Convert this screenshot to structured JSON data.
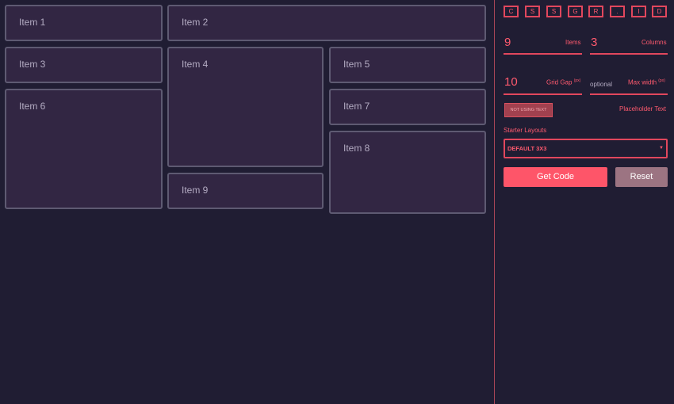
{
  "grid": {
    "items": [
      {
        "label": "Item 1"
      },
      {
        "label": "Item 2"
      },
      {
        "label": "Item 3"
      },
      {
        "label": "Item 4"
      },
      {
        "label": "Item 5"
      },
      {
        "label": "Item 6"
      },
      {
        "label": "Item 7"
      },
      {
        "label": "Item 8"
      },
      {
        "label": "Item 9"
      }
    ]
  },
  "sidebar": {
    "logo_letters": [
      "C",
      "S",
      "S",
      "G",
      "R",
      ".",
      "I",
      "D"
    ],
    "items_field": {
      "value": "9",
      "label": "Items"
    },
    "columns_field": {
      "value": "3",
      "label": "Columns"
    },
    "grid_gap_field": {
      "value": "10",
      "label": "Grid Gap",
      "unit": "(px)"
    },
    "max_width_field": {
      "placeholder": "optional",
      "label": "Max width",
      "unit": "(px)"
    },
    "text_toggle": {
      "label": "NOT USING TEXT",
      "side_label": "Placeholder Text"
    },
    "starter_layouts": {
      "label": "Starter Layouts",
      "selected": "DEFAULT 3X3",
      "arrow": "▼"
    },
    "get_code_label": "Get Code",
    "reset_label": "Reset"
  },
  "colors": {
    "background": "#201d33",
    "item_fill": "#322643",
    "item_border": "#5e5a72",
    "accent": "#ff5a6e",
    "reset_button": "#9c7482"
  }
}
